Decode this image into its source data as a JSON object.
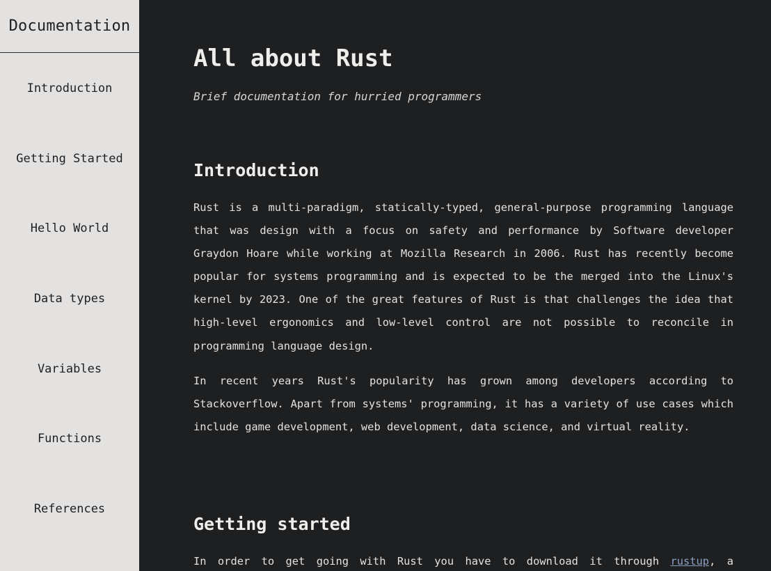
{
  "sidebar": {
    "title": "Documentation",
    "items": [
      {
        "label": "Introduction"
      },
      {
        "label": "Getting Started"
      },
      {
        "label": "Hello World"
      },
      {
        "label": "Data types"
      },
      {
        "label": "Variables"
      },
      {
        "label": "Functions"
      },
      {
        "label": "References"
      }
    ]
  },
  "main": {
    "title": "All about Rust",
    "subtitle": "Brief documentation for hurried programmers",
    "sections": [
      {
        "heading": "Introduction",
        "paragraphs": [
          "Rust is a multi-paradigm, statically-typed, general-purpose programming language that was design with a focus on safety and performance by Software developer Graydon Hoare while working at Mozilla Research in 2006. Rust has recently become popular for systems programming and is expected to be the merged into the Linux's kernel by 2023. One of the great features of Rust is that challenges the idea that high-level ergonomics and low-level control are not possible to reconcile in programming language design.",
          "In recent years Rust's popularity has grown among developers according to Stackoverflow. Apart from systems' programming, it has a variety of use cases which include game development, web development, data science, and virtual reality."
        ]
      },
      {
        "heading": "Getting started",
        "paragraph_before_link": "In order to get going with Rust you have to download it through ",
        "link_text": "rustup",
        "paragraph_after_link": ", a"
      }
    ]
  },
  "colors": {
    "background": "#1e1f21",
    "sidebar_background": "#e4e2e0",
    "text": "#e3e2df",
    "link": "#8aa0c2"
  }
}
